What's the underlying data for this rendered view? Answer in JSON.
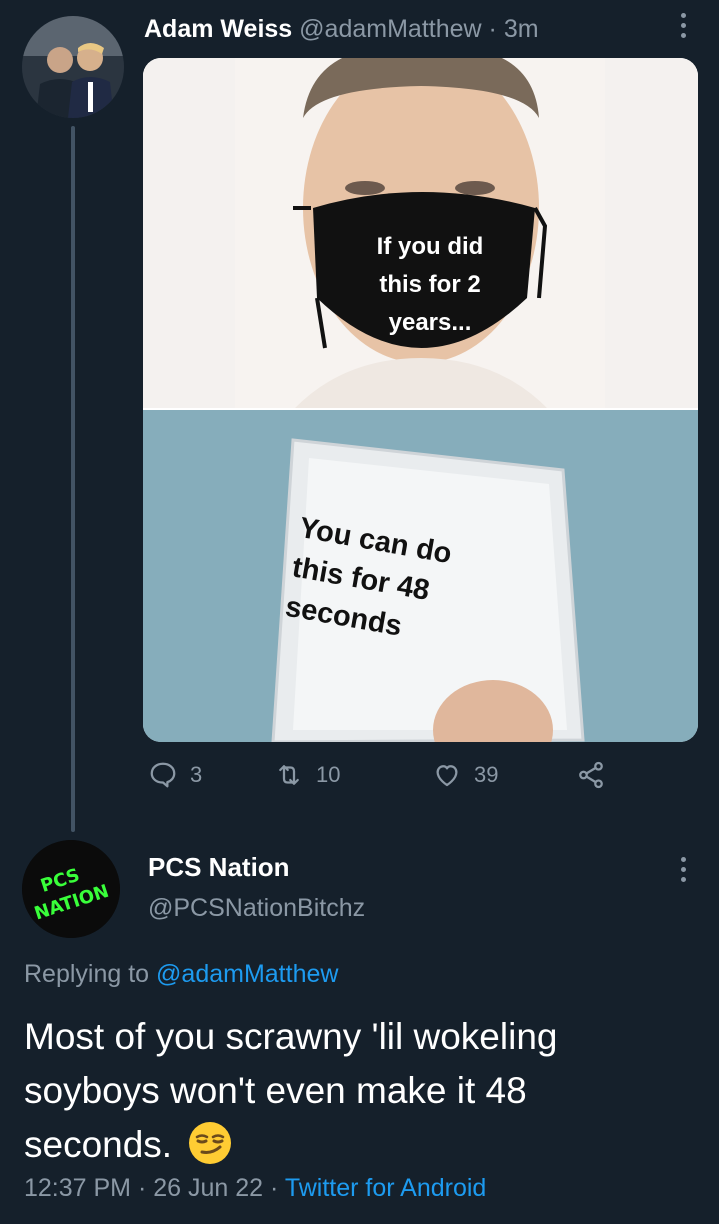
{
  "tweet1": {
    "author_name": "Adam Weiss",
    "handle": "@adamMatthew",
    "separator": "·",
    "age": "3m",
    "more_icon": "more-vertical-icon",
    "media": {
      "mask_caption_lines": [
        "If you did",
        "this for 2",
        "years..."
      ],
      "packet_caption_lines": [
        "You can do",
        "this for 48",
        "seconds"
      ]
    },
    "actions": {
      "reply_count": "3",
      "retweet_count": "10",
      "like_count": "39",
      "reply_icon": "reply-icon",
      "retweet_icon": "retweet-icon",
      "like_icon": "heart-icon",
      "share_icon": "share-icon"
    }
  },
  "tweet2": {
    "author_name": "PCS Nation",
    "handle": "@PCSNationBitchz",
    "avatar_text_lines": [
      "PCS",
      "NATION"
    ],
    "replying_label": "Replying to",
    "replying_handle": "@adamMatthew",
    "body": "Most of you scrawny 'lil wokeling soyboys won't even make it 48 seconds.",
    "emoji_icon": "smirking-face-emoji",
    "time": "12:37 PM",
    "sep1": "·",
    "date": "26 Jun 22",
    "sep2": "·",
    "source": "Twitter for Android"
  },
  "colors": {
    "background": "#15202b",
    "muted_text": "#8b98a5",
    "link": "#1d9bf0",
    "thread_line": "#425364",
    "avatar_accent": "#39ff3a"
  }
}
